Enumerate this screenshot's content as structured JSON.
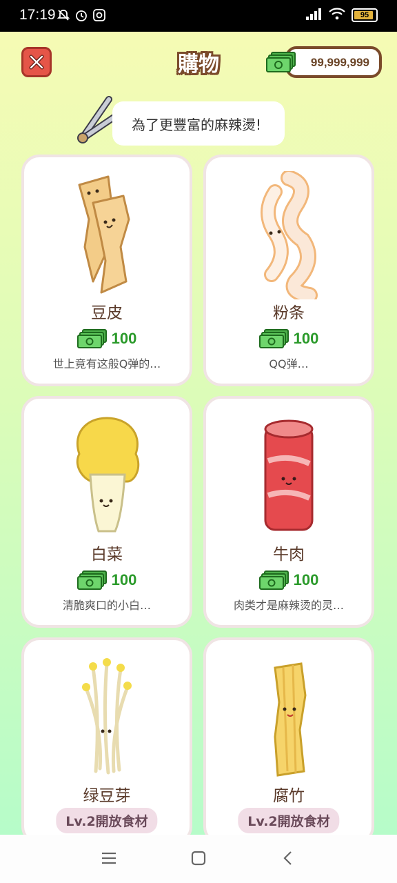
{
  "status_bar": {
    "time": "17:19",
    "battery": "95",
    "battery_level": 0.95
  },
  "header": {
    "title": "購物",
    "money": "99,999,999",
    "close_icon": "close-x-icon",
    "money_icon": "cash-icon"
  },
  "banner": {
    "speech": "為了更豐富的麻辣燙!"
  },
  "items": [
    {
      "name": "豆皮",
      "price": "100",
      "desc": "世上竟有这般Q弹的…"
    },
    {
      "name": "粉条",
      "price": "100",
      "desc": "QQ弹…"
    },
    {
      "name": "白菜",
      "price": "100",
      "desc": "清脆爽口的小白…"
    },
    {
      "name": "牛肉",
      "price": "100",
      "desc": "肉类才是麻辣烫的灵…"
    },
    {
      "name": "绿豆芽",
      "lock": "Lv.2開放食材"
    },
    {
      "name": "腐竹",
      "lock": "Lv.2開放食材"
    }
  ],
  "colors": {
    "accent_green": "#2a9a2a",
    "brown": "#7a4a2a",
    "close_red": "#e55548"
  }
}
